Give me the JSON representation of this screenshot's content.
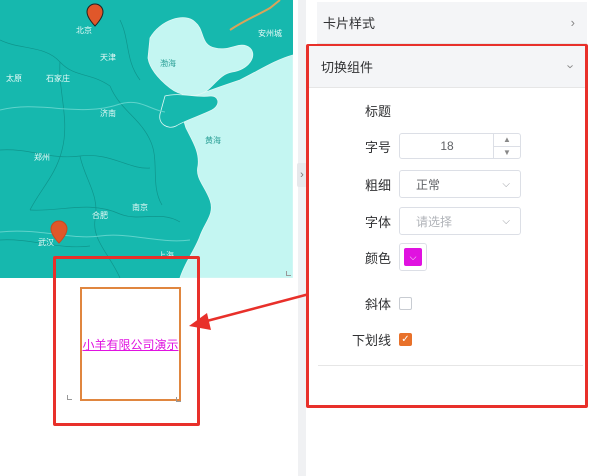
{
  "map": {
    "labels": {
      "beijing": "北京",
      "tianjin": "天津",
      "taiyuan": "太原",
      "shijiazhuang": "石家庄",
      "jinan": "济南",
      "zhengzhou": "郑州",
      "hefei": "合肥",
      "nanjing": "南京",
      "wuhan": "武汉",
      "shanghai": "上海",
      "bohai": "渤海",
      "huanghai": "黄海",
      "anqingcheng": "安州城"
    },
    "pin_color": "#e0572a",
    "land_color": "#16b8ae",
    "sea_color": "#c4f6f2"
  },
  "preview": {
    "card_text": "小羊有限公司演示",
    "text_color": "#e012e0",
    "card_border_color": "#e0863f"
  },
  "panel": {
    "sections": [
      {
        "title": "卡片样式",
        "chevron": "chevron-right-icon"
      },
      {
        "title": "切换组件",
        "chevron": "chevron-down-icon"
      }
    ],
    "form": {
      "title_label": "标题",
      "font_size_label": "字号",
      "font_size_value": "18",
      "weight_label": "粗细",
      "weight_value": "正常",
      "font_label": "字体",
      "font_placeholder": "请选择",
      "color_label": "颜色",
      "color_value": "#e012e0",
      "italic_label": "斜体",
      "italic_checked": false,
      "underline_label": "下划线",
      "underline_checked": true
    }
  },
  "annotations": {
    "highlight_color": "#e8302a"
  }
}
